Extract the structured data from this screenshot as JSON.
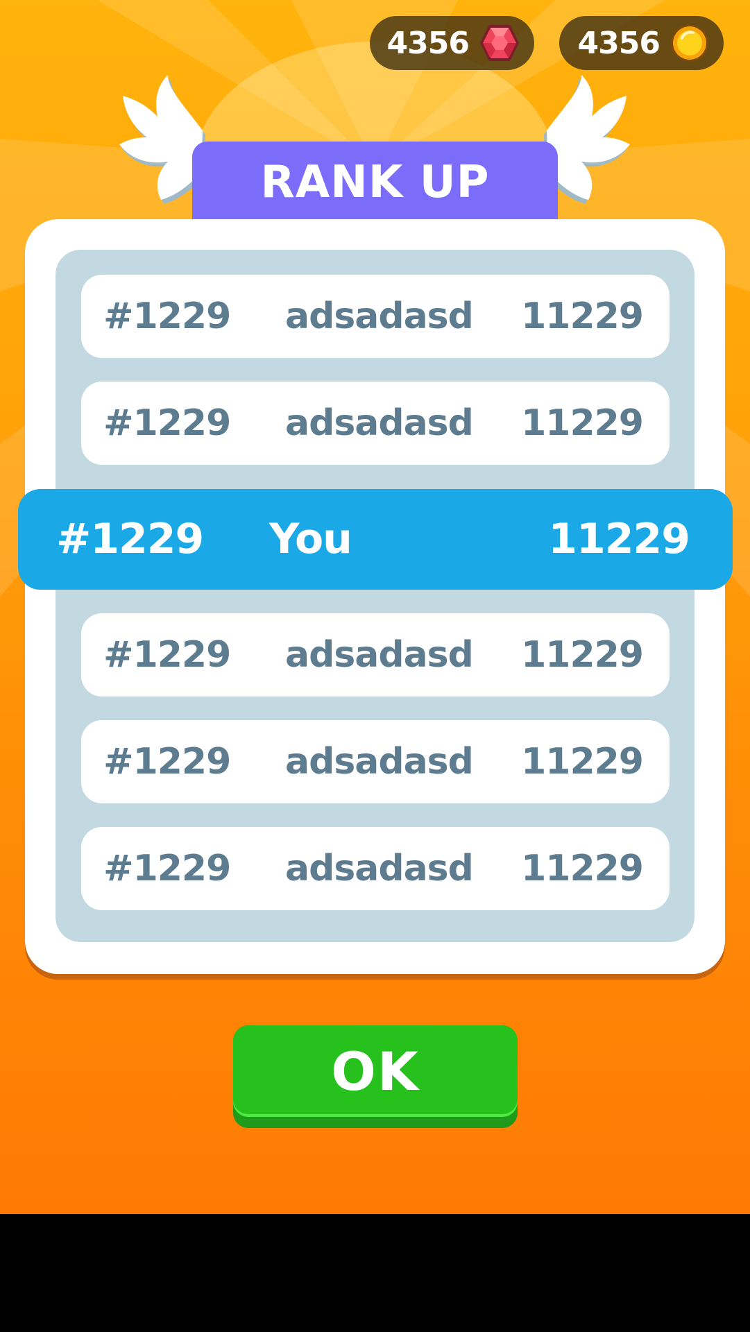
{
  "currency": {
    "gems": {
      "value": "4356",
      "icon": "red-gem-icon"
    },
    "coins": {
      "value": "4356",
      "icon": "gold-coin-icon"
    }
  },
  "dialog": {
    "title": "RANK UP",
    "rows_above": [
      {
        "rank": "#1229",
        "name": "adsadasd",
        "score": "11229"
      },
      {
        "rank": "#1229",
        "name": "adsadasd",
        "score": "11229"
      }
    ],
    "player_row": {
      "rank": "#1229",
      "name": "You",
      "score": "11229"
    },
    "rows_below": [
      {
        "rank": "#1229",
        "name": "adsadasd",
        "score": "11229"
      },
      {
        "rank": "#1229",
        "name": "adsadasd",
        "score": "11229"
      },
      {
        "rank": "#1229",
        "name": "adsadasd",
        "score": "11229"
      }
    ],
    "ok_label": "OK"
  },
  "colors": {
    "background_top": "#ffb30c",
    "background_bottom": "#ff7a04",
    "title_tab": "#7b6dfa",
    "player_row": "#1aa8e6",
    "row_text": "#5e7c90",
    "list_background": "#c3d9e1",
    "ok_button": "#27c11e"
  }
}
